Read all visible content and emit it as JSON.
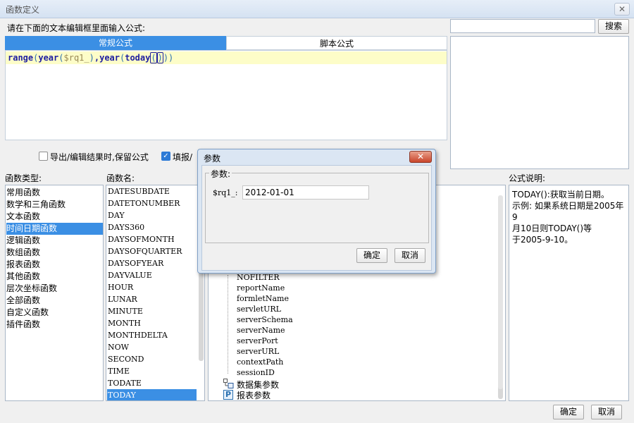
{
  "window": {
    "title": "函数定义",
    "close_glyph": "✕"
  },
  "prompt": "请在下面的文本编辑框里面输入公式:",
  "search": {
    "value": "",
    "button": "搜索"
  },
  "tabs": [
    {
      "label": "常规公式",
      "active": true
    },
    {
      "label": "脚本公式",
      "active": false
    }
  ],
  "formula": {
    "t1": "range",
    "t2": "(",
    "t3": "year",
    "t4": "(",
    "t5": "$rq1_",
    "t6": ")",
    "t7": ",",
    "t8": "year",
    "t9": "(",
    "t10": "today",
    "t11": "(",
    "t12": ")",
    "t13": "))"
  },
  "options": {
    "keep_formula": {
      "label": "导出/编辑结果时,保留公式",
      "checked": false
    },
    "fill_option": {
      "label": "填报/",
      "checked": true
    }
  },
  "categories": {
    "header": "函数类型:",
    "items": [
      "常用函数",
      "数学和三角函数",
      "文本函数",
      "时间日期函数",
      "逻辑函数",
      "数组函数",
      "报表函数",
      "其他函数",
      "层次坐标函数",
      "全部函数",
      "自定义函数",
      "插件函数"
    ],
    "selected_index": 3
  },
  "functions": {
    "header": "函数名:",
    "items": [
      "DATESUBDATE",
      "DATETONUMBER",
      "DAY",
      "DAYS360",
      "DAYSOFMONTH",
      "DAYSOFQUARTER",
      "DAYSOFYEAR",
      "DAYVALUE",
      "HOUR",
      "LUNAR",
      "MINUTE",
      "MONTH",
      "MONTHDELTA",
      "NOW",
      "SECOND",
      "TIME",
      "TODATE",
      "TODAY"
    ],
    "selected_index": 17
  },
  "params_tree": {
    "items": [
      "NOFILTER",
      "reportName",
      "formletName",
      "servletURL",
      "serverSchema",
      "serverName",
      "serverPort",
      "serverURL",
      "contextPath",
      "sessionID"
    ],
    "dataset_params": "数据集参数",
    "report_params": "报表参数",
    "report_icon_glyph": "P"
  },
  "description": {
    "header": "公式说明:",
    "lines": [
      "TODAY():获取当前日期。",
      "示例: 如果系统日期是2005年9",
      "月10日则TODAY()等",
      "于2005-9-10。"
    ]
  },
  "footer": {
    "ok": "确定",
    "cancel": "取消"
  },
  "modal": {
    "title": "参数",
    "close_glyph": "✕",
    "group_label": "参数:",
    "param_label": "$rq1_:",
    "param_value": "2012-01-01",
    "ok": "确定",
    "cancel": "取消"
  },
  "colors": {
    "accent": "#3b8fe4",
    "editor_line": "#fdfdc8",
    "keyword": "#1d1da0"
  }
}
